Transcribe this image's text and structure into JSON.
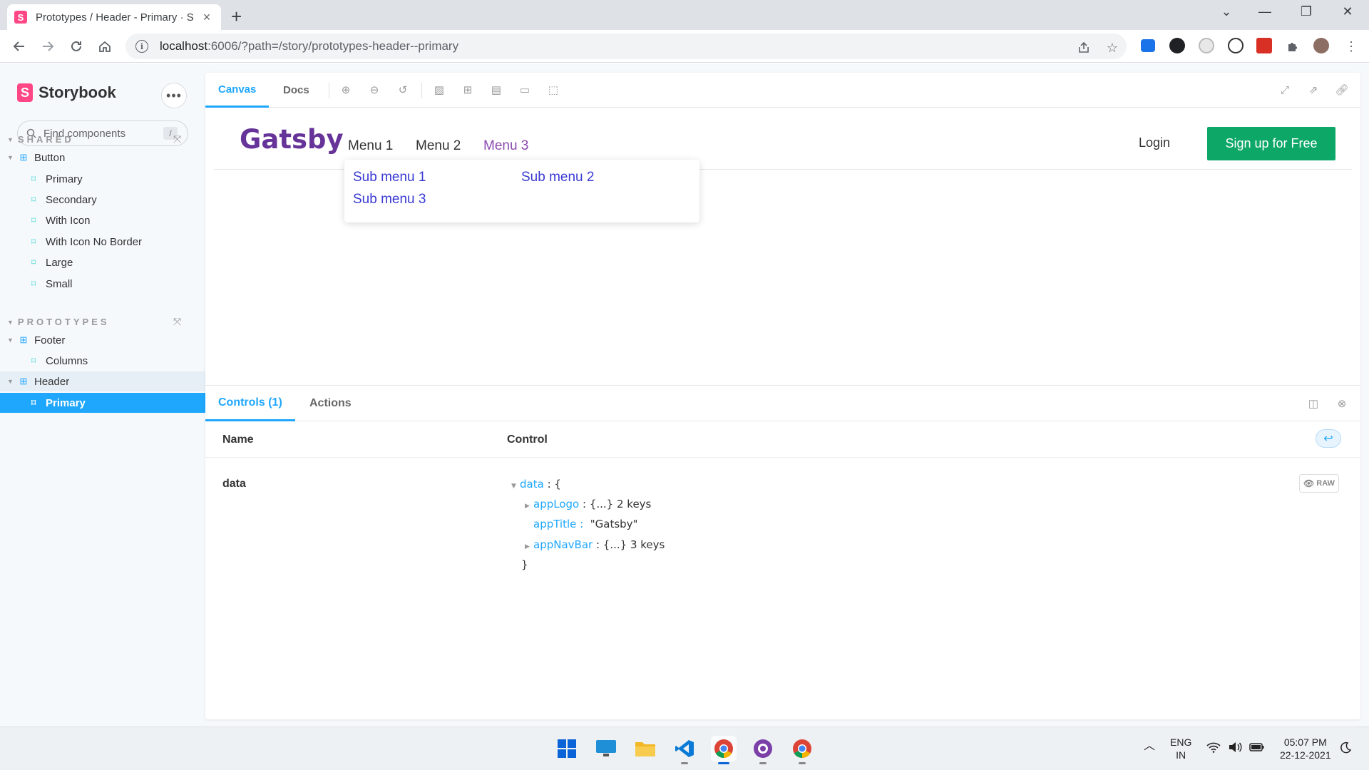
{
  "browser": {
    "tab_title": "Prototypes / Header - Primary · S",
    "tab_close": "×",
    "new_tab": "+",
    "url_host": "localhost",
    "url_rest": ":6006/?path=/story/prototypes-header--primary",
    "window_controls": [
      "⌄",
      "—",
      "❐",
      "✕"
    ]
  },
  "sidebar": {
    "brand": "Storybook",
    "search_placeholder": "Find components",
    "search_shortcut": "/",
    "sections": [
      {
        "title": "SHARED"
      },
      {
        "title": "PROTOTYPES"
      }
    ],
    "tree": [
      {
        "label": "Button",
        "type": "component"
      },
      {
        "label": "Primary",
        "type": "story"
      },
      {
        "label": "Secondary",
        "type": "story"
      },
      {
        "label": "With Icon",
        "type": "story"
      },
      {
        "label": "With Icon No Border",
        "type": "story"
      },
      {
        "label": "Large",
        "type": "story"
      },
      {
        "label": "Small",
        "type": "story"
      },
      {
        "label": "Footer",
        "type": "component"
      },
      {
        "label": "Columns",
        "type": "story"
      },
      {
        "label": "Header",
        "type": "component"
      },
      {
        "label": "Primary",
        "type": "story",
        "selected": true
      }
    ]
  },
  "toolbar": {
    "tabs": [
      "Canvas",
      "Docs"
    ],
    "active_tab": "Canvas"
  },
  "preview": {
    "app_title": "Gatsby",
    "menus": [
      "Menu 1",
      "Menu 2",
      "Menu 3"
    ],
    "active_menu": "Menu 3",
    "submenus": [
      "Sub menu 1",
      "Sub menu 2",
      "Sub menu 3"
    ],
    "login": "Login",
    "signup": "Sign up for Free"
  },
  "addons": {
    "tabs": [
      "Controls (1)",
      "Actions"
    ],
    "active_tab": "Controls (1)",
    "headers": {
      "name": "Name",
      "control": "Control"
    },
    "row_name": "data",
    "raw_label": "RAW",
    "json": {
      "root_key": "data",
      "root_open": ": {",
      "applogo_key": "appLogo",
      "applogo_val": ": {...} 2 keys",
      "apptitle_key": "appTitle :",
      "apptitle_val": "\"Gatsby\"",
      "appnavbar_key": "appNavBar",
      "appnavbar_val": ": {...} 3 keys",
      "close": "}"
    }
  },
  "taskbar": {
    "lang": "ENG",
    "region": "IN",
    "time": "05:07 PM",
    "date": "22-12-2021"
  },
  "colors": {
    "storybook_accent": "#1ea7fd",
    "storybook_pink": "#ff4785",
    "gatsby_purple": "#663399",
    "signup_green": "#0da768",
    "submenu_link": "#3a3ad4"
  }
}
